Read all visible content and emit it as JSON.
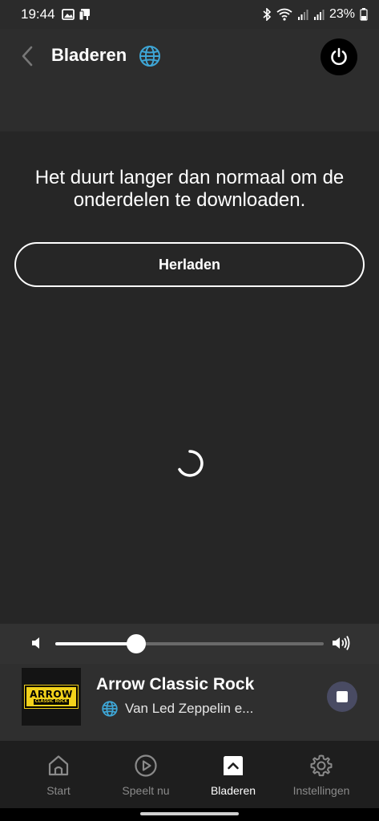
{
  "status_bar": {
    "time": "19:44",
    "battery": "23%"
  },
  "header": {
    "title": "Bladeren"
  },
  "main": {
    "message": "Het duurt langer dan normaal om de onderdelen te downloaden.",
    "reload_label": "Herladen"
  },
  "volume": {
    "level": 0.3
  },
  "now_playing": {
    "station": "Arrow Classic Rock",
    "subtitle": "Van Led Zeppelin e...",
    "logo_line1": "ARROW",
    "logo_line2": "CLASSIC ROCK"
  },
  "bottom_nav": {
    "items": [
      {
        "label": "Start",
        "icon": "home-icon",
        "active": false
      },
      {
        "label": "Speelt nu",
        "icon": "play-circle-icon",
        "active": false
      },
      {
        "label": "Bladeren",
        "icon": "browse-icon",
        "active": true
      },
      {
        "label": "Instellingen",
        "icon": "gear-icon",
        "active": false
      }
    ]
  },
  "colors": {
    "header_bg": "#2d2d2d",
    "main_bg": "#262626",
    "nav_bg": "#1e1e1e",
    "stop_button": "#494b63",
    "globe": "#3ea6d6"
  }
}
